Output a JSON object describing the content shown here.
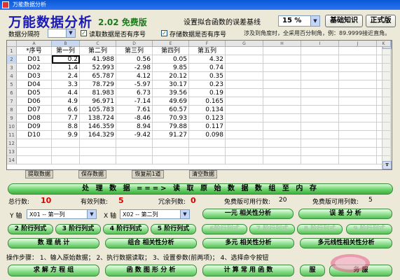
{
  "window": {
    "title": "万能数据分析"
  },
  "header": {
    "app_title": "万能数据分析",
    "version": "2.02 免费版",
    "error_label": "设置拟合函数的误差基线",
    "error_value": "15 %",
    "btn_basic": "基础知识",
    "btn_official": "正式版"
  },
  "options": {
    "sep_label": "数据分隔符",
    "read_seq_label": "读取数据是否有序号",
    "store_seq_label": "存储数据是否有序号",
    "hint": "涉及到角度时，全采用百分制角，例：89.9999接近直角。"
  },
  "sheet": {
    "col_letters": [
      "A",
      "B",
      "C",
      "D",
      "E",
      "F",
      "G",
      "H",
      "I",
      "J",
      "K"
    ],
    "rows": [
      [
        "*序号",
        "第一列",
        "第二列",
        "第三列",
        "第四列",
        "第五列"
      ],
      [
        "D01",
        "0.2",
        "41.988",
        "0.56",
        "0.05",
        "4.32"
      ],
      [
        "D02",
        "1.4",
        "52.993",
        "-2.98",
        "9.85",
        "0.74"
      ],
      [
        "D03",
        "2.4",
        "65.787",
        "4.12",
        "20.12",
        "0.35"
      ],
      [
        "D04",
        "3.3",
        "78.729",
        "-5.97",
        "30.17",
        "0.23"
      ],
      [
        "D05",
        "4.4",
        "81.983",
        "6.73",
        "39.56",
        "0.19"
      ],
      [
        "D06",
        "4.9",
        "96.971",
        "-7.14",
        "49.69",
        "0.165"
      ],
      [
        "D07",
        "6.6",
        "105.783",
        "7.61",
        "60.57",
        "0.134"
      ],
      [
        "D08",
        "7.7",
        "138.724",
        "-8.46",
        "70.93",
        "0.123"
      ],
      [
        "D09",
        "8.8",
        "146.359",
        "8.94",
        "79.88",
        "0.117"
      ],
      [
        "D10",
        "9.9",
        "164.329",
        "-9.42",
        "91.27",
        "0.098"
      ],
      [
        "",
        "",
        "",
        "",
        "",
        ""
      ],
      [
        "",
        "",
        "",
        "",
        "",
        ""
      ],
      [
        "",
        "",
        "",
        "",
        "",
        ""
      ]
    ],
    "row_numbers": [
      "1",
      "2",
      "3",
      "4",
      "5",
      "6",
      "7",
      "8",
      "9",
      "10",
      "11",
      "12",
      "13",
      "14"
    ]
  },
  "sheet_buttons": [
    "提取数据",
    "保存数据",
    "恢复前1道",
    "清空数据"
  ],
  "process_bar": "处 理 数 据 ===> 读 取 原 始 数 据 数 组 至 内 存",
  "stats": {
    "total_label": "总行数:",
    "total": "10",
    "valid_label": "有效列数:",
    "valid": "5",
    "redundant_label": "冗余列数:",
    "redundant": "0",
    "free_rows_label": "免费版可用行数:",
    "free_rows": "20",
    "free_cols_label": "免费版可用列数:",
    "free_cols": "5"
  },
  "axes": {
    "y_label": "Y 轴",
    "y_value": "X01 -- 第一列",
    "x_label": "X 轴",
    "x_value": "X02 -- 第二列"
  },
  "buttons": {
    "unary": "一元 相关性分析",
    "error": "误 差 分 析",
    "det": [
      "2 阶行列式",
      "3 阶行列式",
      "4 阶行列式",
      "5 阶行列式",
      "6阶行列式",
      "7 阶行列式",
      "8 阶行列式",
      "9 阶行列式"
    ],
    "stats": "数 理 统 计",
    "combo": "组合 相关性分析",
    "multi": "多元 相关性分析",
    "multi_linear": "多元线性相关性分析",
    "equations": "求 解 方 程 组",
    "graph": "函 数 图 形 分 析",
    "calc": "计 算 常 用 函 数",
    "service": "服",
    "service2": "务 服"
  },
  "steps": "操作步骤： 1、输入原始数据； 2、执行数据读取； 3、设置参数(前两项)； 4、选择命令按钮"
}
